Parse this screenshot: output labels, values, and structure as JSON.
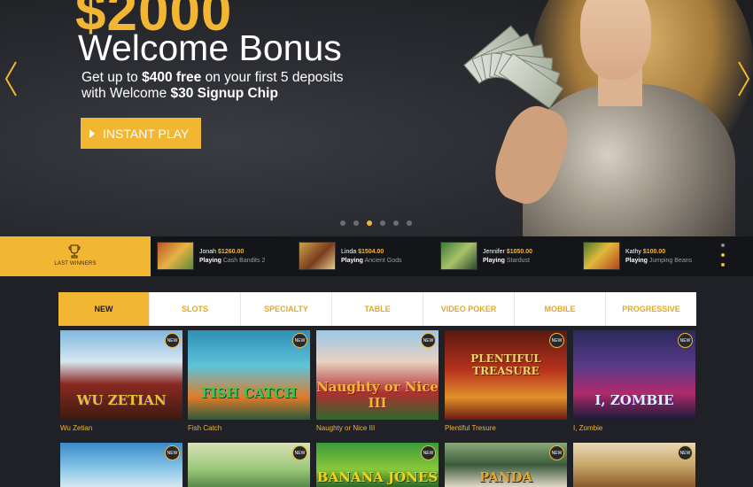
{
  "hero": {
    "amount": "$2000",
    "title": "Welcome Bonus",
    "line1_pre": "Get up to ",
    "line1_bold": "$400 free",
    "line1_post": " on your first 5 deposits",
    "line2_pre": "with Welcome ",
    "line2_bold": "$30 Signup Chip",
    "button_label": "INSTANT PLAY",
    "slide_count": 6,
    "active_slide": 3
  },
  "winners": {
    "label": "LAST WINNERS",
    "playing_label": "Playing",
    "items": [
      {
        "name": "Jonah",
        "amount": "$1260.00",
        "game": "Cash Bandits 2"
      },
      {
        "name": "Linda",
        "amount": "$1504.00",
        "game": "Ancient Gods"
      },
      {
        "name": "Jennifer",
        "amount": "$1050.00",
        "game": "Stardust"
      },
      {
        "name": "Kathy",
        "amount": "$100.00",
        "game": "Jumping Beans"
      }
    ]
  },
  "tabs": [
    "NEW",
    "SLOTS",
    "SPECIALTY",
    "TABLE",
    "VIDEO POKER",
    "MOBILE",
    "PROGRESSIVE"
  ],
  "active_tab": "NEW",
  "games": [
    {
      "title": "Wu Zetian",
      "badge": "NEW",
      "art": "WU ZETIAN"
    },
    {
      "title": "Fish Catch",
      "badge": "NEW",
      "art": "FISH CATCH"
    },
    {
      "title": "Naughty or Nice III",
      "badge": "NEW",
      "art": "Naughty or Nice III"
    },
    {
      "title": "Plentiful Tresure",
      "badge": "NEW",
      "art": "PLENTIFUL TREASURE"
    },
    {
      "title": "I, Zombie",
      "badge": "NEW",
      "art": "I, ZOMBIE"
    },
    {
      "title": "",
      "badge": "NEW",
      "art": ""
    },
    {
      "title": "",
      "badge": "NEW",
      "art": ""
    },
    {
      "title": "",
      "badge": "NEW",
      "art": "BANANA JONES"
    },
    {
      "title": "",
      "badge": "NEW",
      "art": "PANDA"
    },
    {
      "title": "",
      "badge": "NEW",
      "art": ""
    }
  ],
  "colors": {
    "accent": "#f2b632",
    "background": "#1f2126",
    "bar": "#141519"
  }
}
